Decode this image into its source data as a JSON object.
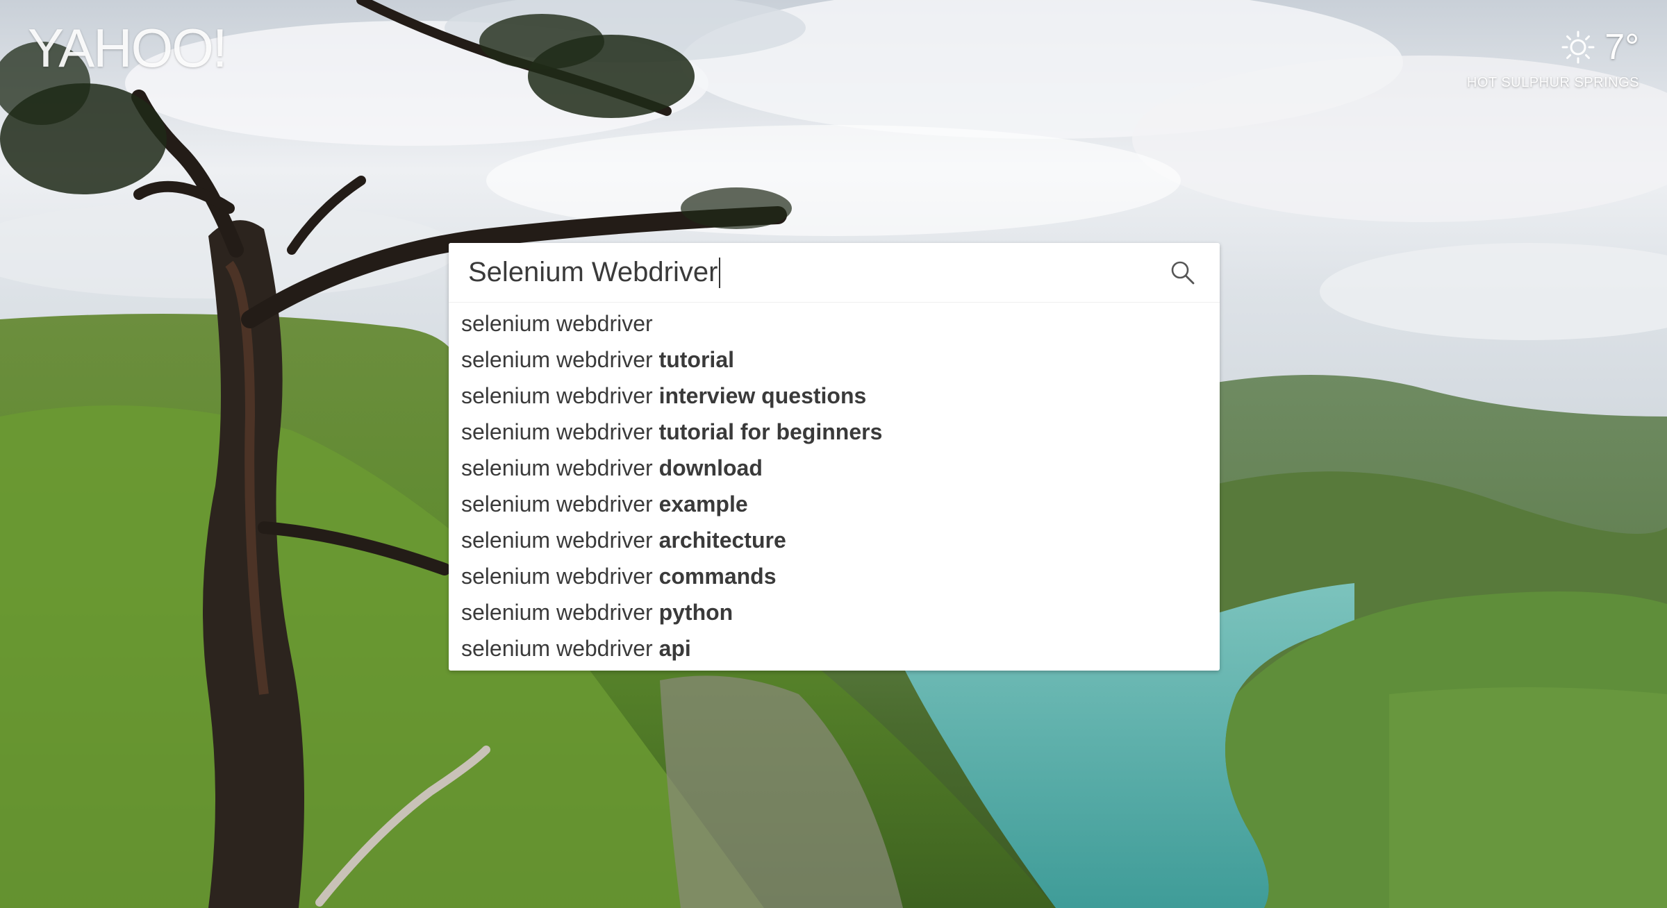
{
  "brand": {
    "logo_text": "YAHOO!"
  },
  "weather": {
    "icon": "sun-icon",
    "temperature": "7°",
    "location": "HOT SULPHUR SPRINGS"
  },
  "search": {
    "query": "Selenium Webdriver",
    "icon": "search-icon"
  },
  "suggestions": [
    {
      "prefix": "selenium webdriver",
      "completion": ""
    },
    {
      "prefix": "selenium webdriver ",
      "completion": "tutorial"
    },
    {
      "prefix": "selenium webdriver ",
      "completion": "interview questions"
    },
    {
      "prefix": "selenium webdriver ",
      "completion": "tutorial for beginners"
    },
    {
      "prefix": "selenium webdriver ",
      "completion": "download"
    },
    {
      "prefix": "selenium webdriver ",
      "completion": "example"
    },
    {
      "prefix": "selenium webdriver ",
      "completion": "architecture"
    },
    {
      "prefix": "selenium webdriver ",
      "completion": "commands"
    },
    {
      "prefix": "selenium webdriver ",
      "completion": "python"
    },
    {
      "prefix": "selenium webdriver ",
      "completion": "api"
    }
  ],
  "colors": {
    "panel_background": "#ffffff",
    "text": "#3a3a3a",
    "lake": "#5fb3ae"
  }
}
